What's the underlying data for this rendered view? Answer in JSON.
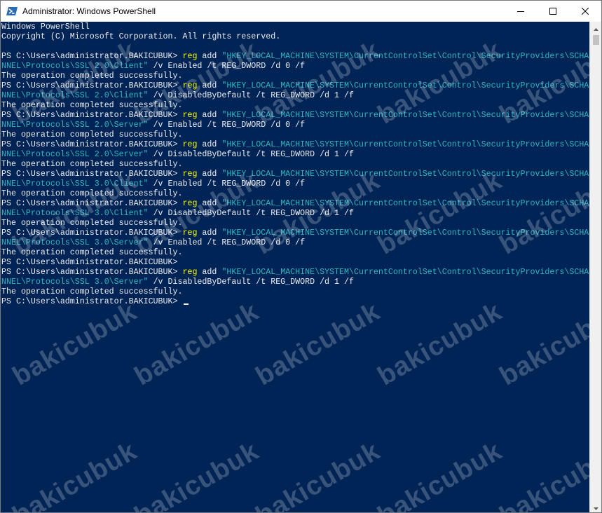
{
  "window": {
    "title": "Administrator: Windows PowerShell",
    "icon": "powershell-icon",
    "controls": [
      "minimize-icon",
      "maximize-icon",
      "close-icon"
    ]
  },
  "colors": {
    "console_bg": "#012456",
    "text": "#eeedf0",
    "command": "#ffff00",
    "string": "#2bb7c4",
    "titlebar": "#ffffff"
  },
  "console": {
    "lines": [
      [
        {
          "t": "Windows PowerShell",
          "c": "w"
        }
      ],
      [
        {
          "t": "Copyright (C) Microsoft Corporation. All rights reserved.",
          "c": "w"
        }
      ],
      [
        {
          "t": "",
          "c": "w"
        }
      ],
      [
        {
          "t": "PS C:\\Users\\administrator.BAKICUBUK> ",
          "c": "w"
        },
        {
          "t": "reg",
          "c": "y"
        },
        {
          "t": " add ",
          "c": "w"
        },
        {
          "t": "\"HKEY_LOCAL_MACHINE\\SYSTEM\\CurrentControlSet\\Control\\SecurityProviders\\SCHA",
          "c": "c"
        }
      ],
      [
        {
          "t": "NNEL\\Protocols\\SSL 2.0\\Client\"",
          "c": "c"
        },
        {
          "t": " /v Enabled /t REG_DWORD /d 0 /f",
          "c": "w"
        }
      ],
      [
        {
          "t": "The operation completed successfully.",
          "c": "w"
        }
      ],
      [
        {
          "t": "PS C:\\Users\\administrator.BAKICUBUK> ",
          "c": "w"
        },
        {
          "t": "reg",
          "c": "y"
        },
        {
          "t": " add ",
          "c": "w"
        },
        {
          "t": "\"HKEY_LOCAL_MACHINE\\SYSTEM\\CurrentControlSet\\Control\\SecurityProviders\\SCHA",
          "c": "c"
        }
      ],
      [
        {
          "t": "NNEL\\Protocols\\SSL 2.0\\Client\"",
          "c": "c"
        },
        {
          "t": " /v DisabledByDefault /t REG_DWORD /d 1 /f",
          "c": "w"
        }
      ],
      [
        {
          "t": "The operation completed successfully.",
          "c": "w"
        }
      ],
      [
        {
          "t": "PS C:\\Users\\administrator.BAKICUBUK> ",
          "c": "w"
        },
        {
          "t": "reg",
          "c": "y"
        },
        {
          "t": " add ",
          "c": "w"
        },
        {
          "t": "\"HKEY_LOCAL_MACHINE\\SYSTEM\\CurrentControlSet\\Control\\SecurityProviders\\SCHA",
          "c": "c"
        }
      ],
      [
        {
          "t": "NNEL\\Protocols\\SSL 2.0\\Server\"",
          "c": "c"
        },
        {
          "t": " /v Enabled /t REG_DWORD /d 0 /f",
          "c": "w"
        }
      ],
      [
        {
          "t": "The operation completed successfully.",
          "c": "w"
        }
      ],
      [
        {
          "t": "PS C:\\Users\\administrator.BAKICUBUK> ",
          "c": "w"
        },
        {
          "t": "reg",
          "c": "y"
        },
        {
          "t": " add ",
          "c": "w"
        },
        {
          "t": "\"HKEY_LOCAL_MACHINE\\SYSTEM\\CurrentControlSet\\Control\\SecurityProviders\\SCHA",
          "c": "c"
        }
      ],
      [
        {
          "t": "NNEL\\Protocols\\SSL 2.0\\Server\"",
          "c": "c"
        },
        {
          "t": " /v DisabledByDefault /t REG_DWORD /d 1 /f",
          "c": "w"
        }
      ],
      [
        {
          "t": "The operation completed successfully.",
          "c": "w"
        }
      ],
      [
        {
          "t": "PS C:\\Users\\administrator.BAKICUBUK> ",
          "c": "w"
        },
        {
          "t": "reg",
          "c": "y"
        },
        {
          "t": " add ",
          "c": "w"
        },
        {
          "t": "\"HKEY_LOCAL_MACHINE\\SYSTEM\\CurrentControlSet\\Control\\SecurityProviders\\SCHA",
          "c": "c"
        }
      ],
      [
        {
          "t": "NNEL\\Protocols\\SSL 3.0\\Client\"",
          "c": "c"
        },
        {
          "t": " /v Enabled /t REG_DWORD /d 0 /f",
          "c": "w"
        }
      ],
      [
        {
          "t": "The operation completed successfully.",
          "c": "w"
        }
      ],
      [
        {
          "t": "PS C:\\Users\\administrator.BAKICUBUK> ",
          "c": "w"
        },
        {
          "t": "reg",
          "c": "y"
        },
        {
          "t": " add ",
          "c": "w"
        },
        {
          "t": "\"HKEY_LOCAL_MACHINE\\SYSTEM\\CurrentControlSet\\Control\\SecurityProviders\\SCHA",
          "c": "c"
        }
      ],
      [
        {
          "t": "NNEL\\Protocols\\SSL 3.0\\Client\"",
          "c": "c"
        },
        {
          "t": " /v DisabledByDefault /t REG_DWORD /d 1 /f",
          "c": "w"
        }
      ],
      [
        {
          "t": "The operation completed successfully.",
          "c": "w"
        }
      ],
      [
        {
          "t": "PS C:\\Users\\administrator.BAKICUBUK> ",
          "c": "w"
        },
        {
          "t": "reg",
          "c": "y"
        },
        {
          "t": " add ",
          "c": "w"
        },
        {
          "t": "\"HKEY_LOCAL_MACHINE\\SYSTEM\\CurrentControlSet\\Control\\SecurityProviders\\SCHA",
          "c": "c"
        }
      ],
      [
        {
          "t": "NNEL\\Protocols\\SSL 3.0\\Server\"",
          "c": "c"
        },
        {
          "t": " /v Enabled /t REG_DWORD /d 0 /f",
          "c": "w"
        }
      ],
      [
        {
          "t": "The operation completed successfully.",
          "c": "w"
        }
      ],
      [
        {
          "t": "PS C:\\Users\\administrator.BAKICUBUK>",
          "c": "w"
        }
      ],
      [
        {
          "t": "PS C:\\Users\\administrator.BAKICUBUK> ",
          "c": "w"
        },
        {
          "t": "reg",
          "c": "y"
        },
        {
          "t": " add ",
          "c": "w"
        },
        {
          "t": "\"HKEY_LOCAL_MACHINE\\SYSTEM\\CurrentControlSet\\Control\\SecurityProviders\\SCHA",
          "c": "c"
        }
      ],
      [
        {
          "t": "NNEL\\Protocols\\SSL 3.0\\Server\"",
          "c": "c"
        },
        {
          "t": " /v DisabledByDefault /t REG_DWORD /d 1 /f",
          "c": "w"
        }
      ],
      [
        {
          "t": "The operation completed successfully.",
          "c": "w"
        }
      ],
      [
        {
          "t": "PS C:\\Users\\administrator.BAKICUBUK> ",
          "c": "w"
        }
      ]
    ]
  },
  "watermark": {
    "text": "bakicubuk"
  }
}
